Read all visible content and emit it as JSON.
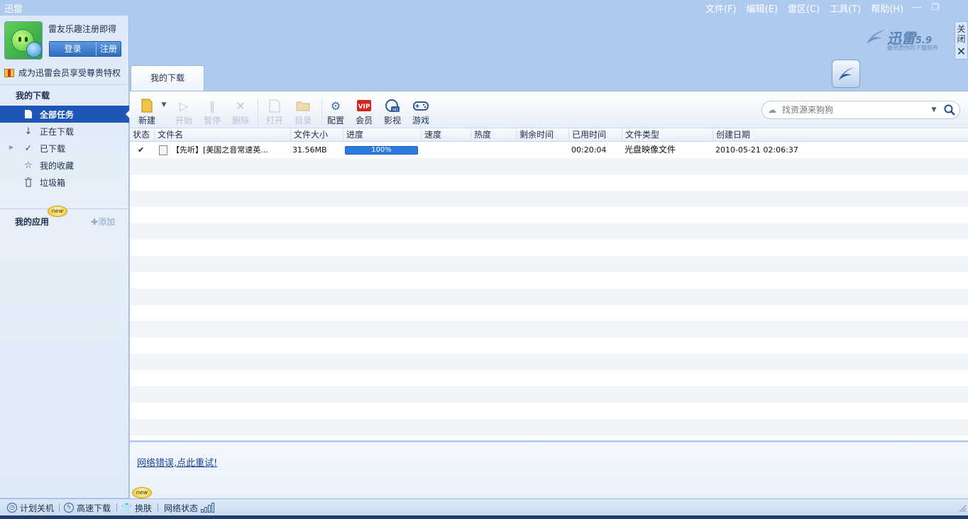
{
  "app": {
    "title": "迅雷"
  },
  "menu": [
    "文件(F)",
    "编辑(E)",
    "雷区(C)",
    "工具(T)",
    "帮助(H)"
  ],
  "window_controls": {
    "minimize": "—",
    "restore": "❐",
    "close_side_label": "关闭",
    "close_side_x": "✕"
  },
  "user": {
    "promo": "雷友乐趣注册即得",
    "login_label": "登录",
    "register_label": "注册",
    "vip_text": "成为迅雷会员享受尊贵特权"
  },
  "sidebar": {
    "section_title": "我的下载",
    "items": [
      {
        "label": "全部任务",
        "icon": "document-icon",
        "active": true
      },
      {
        "label": "正在下载",
        "icon": "down-arrow-icon",
        "active": false
      },
      {
        "label": "已下载",
        "icon": "checkmark-icon",
        "active": false
      },
      {
        "label": "我的收藏",
        "icon": "star-icon",
        "active": false
      },
      {
        "label": "垃圾箱",
        "icon": "trash-icon",
        "active": false
      }
    ],
    "apps_title": "我的应用",
    "new_badge": "new",
    "add_label": "添加"
  },
  "logo": {
    "name": "迅雷",
    "version": "5.9",
    "tagline": "最熟悉你的下载软件"
  },
  "tab": {
    "label": "我的下载"
  },
  "toolbar": {
    "new": "新建",
    "start": "开始",
    "pause": "暂停",
    "delete": "删除",
    "open": "打开",
    "folder": "目录",
    "config": "配置",
    "vip": "会员",
    "video": "影视",
    "games": "游戏"
  },
  "search": {
    "placeholder": "找资源来狗狗"
  },
  "grid": {
    "columns": [
      "状态",
      "文件名",
      "文件大小",
      "进度",
      "速度",
      "热度",
      "剩余时间",
      "已用时间",
      "文件类型",
      "创建日期"
    ],
    "rows": [
      {
        "status": "completed",
        "name": "【先听】[美国之音常速英...",
        "size": "31.56MB",
        "progress": "100%",
        "progress_value": 1.0,
        "speed": "",
        "heat": "",
        "remaining": "",
        "elapsed": "00:20:04",
        "type": "光盘映像文件",
        "created": "2010-05-21 02:06:37"
      }
    ]
  },
  "bottom_panel": {
    "message": "网络错误,点此重试!"
  },
  "statusbar": {
    "shutdown": "计划关机",
    "turbo": "高速下载",
    "skin": "换肤",
    "network": "网络状态",
    "new_badge": "new"
  },
  "colors": {
    "accent": "#1e56b7",
    "frame": "#aecbef",
    "progress": "#2b7be0",
    "ok": "#1e9d1e"
  }
}
